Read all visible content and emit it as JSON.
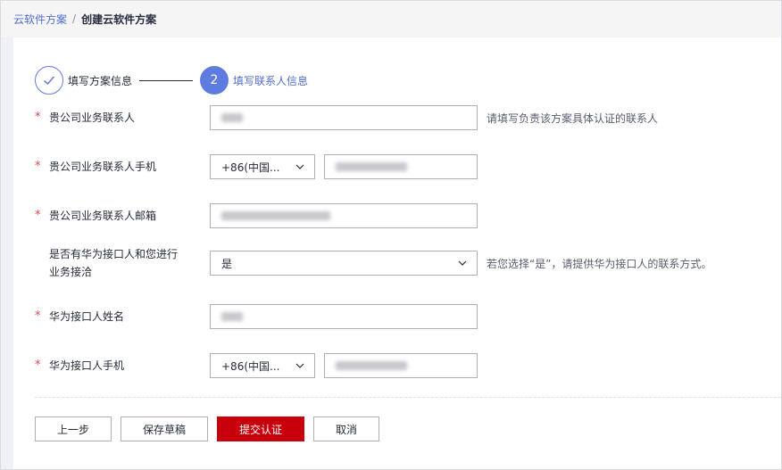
{
  "breadcrumb": {
    "parent": "云软件方案",
    "separator": "/",
    "current": "创建云软件方案"
  },
  "steps": [
    {
      "label": "填写方案信息",
      "state": "done"
    },
    {
      "label": "填写联系人信息",
      "state": "active",
      "number": "2"
    }
  ],
  "form": {
    "contact_name": {
      "label": "贵公司业务联系人",
      "hint": "请填写负责该方案具体认证的联系人"
    },
    "contact_phone": {
      "label": "贵公司业务联系人手机",
      "country_code": "+86(中国..."
    },
    "contact_email": {
      "label": "贵公司业务联系人邮箱"
    },
    "has_interface": {
      "label_line1": "是否有华为接口人和您进行",
      "label_line2": "业务接洽",
      "value": "是",
      "hint": "若您选择“是”，请提供华为接口人的联系方式。"
    },
    "interface_name": {
      "label": "华为接口人姓名"
    },
    "interface_phone": {
      "label": "华为接口人手机",
      "country_code": "+86(中国..."
    },
    "required_mark": "*"
  },
  "buttons": {
    "prev": "上一步",
    "save_draft": "保存草稿",
    "submit": "提交认证",
    "cancel": "取消"
  },
  "colors": {
    "primary": "#c7000b",
    "accent": "#5e7ce0",
    "link": "#526ecc",
    "required": "#e54545"
  }
}
